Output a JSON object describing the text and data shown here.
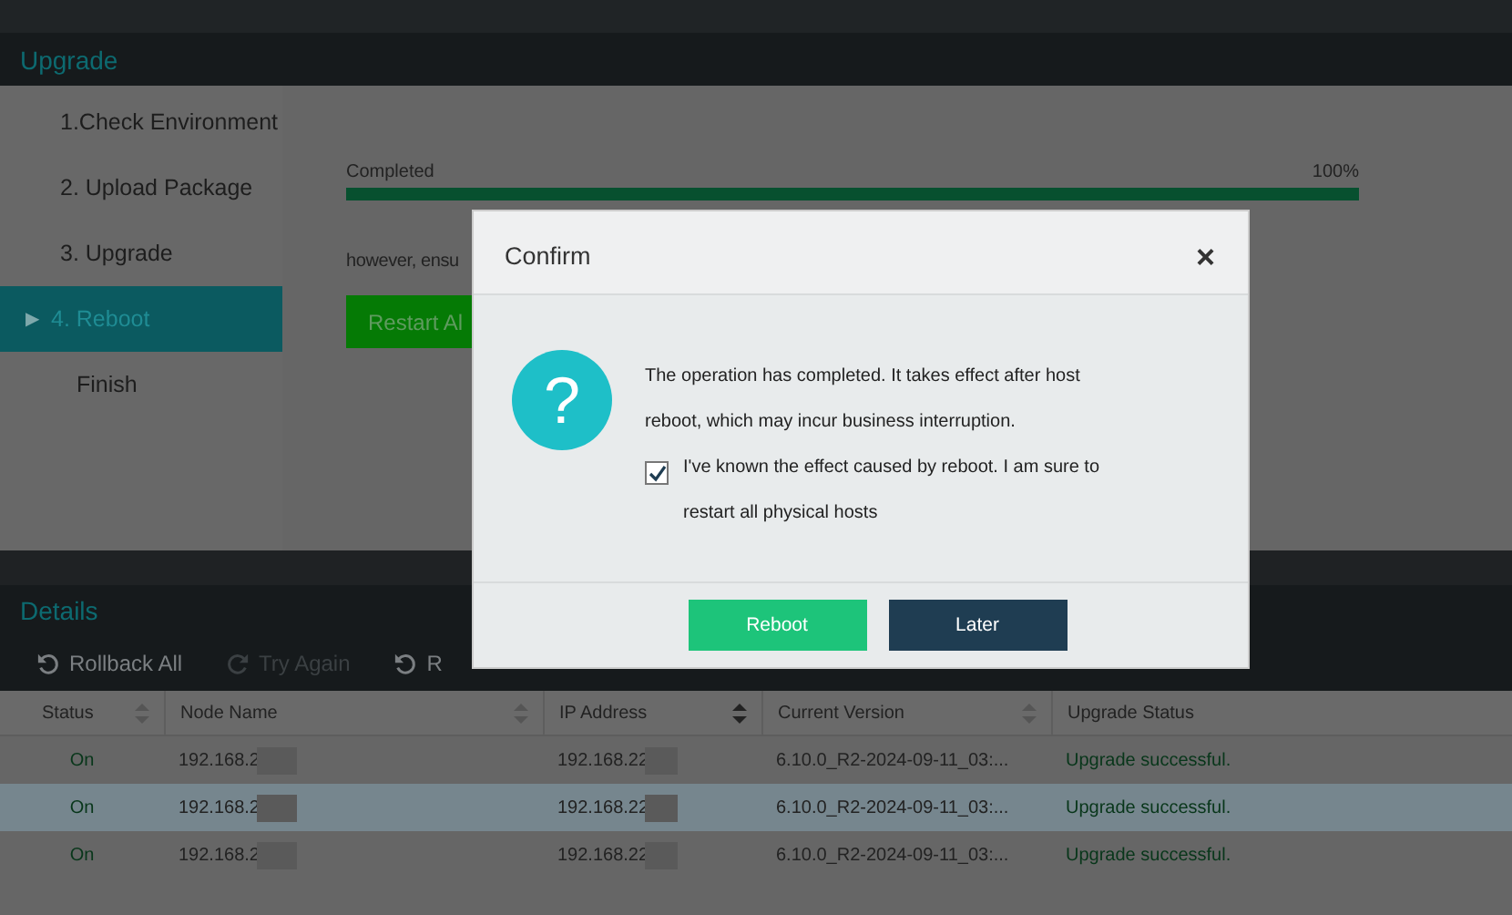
{
  "upgrade": {
    "title": "Upgrade",
    "steps": [
      {
        "label": "1.Check Environment",
        "selected": false
      },
      {
        "label": "2. Upload Package",
        "selected": false
      },
      {
        "label": "3. Upgrade",
        "selected": false
      },
      {
        "label": "4. Reboot",
        "selected": true,
        "marker": "▶"
      },
      {
        "label": "Finish",
        "selected": false
      }
    ],
    "progress": {
      "label": "Completed",
      "reading": "100%",
      "level": 1
    },
    "note": "however, ensu",
    "restart_button": "Restart Al"
  },
  "details": {
    "title": "Details",
    "toolbar": [
      {
        "label": "Rollback All",
        "disabled": false
      },
      {
        "label": "Try Again",
        "disabled": true
      },
      {
        "label": "R",
        "disabled": false
      }
    ],
    "columns": [
      {
        "label": "Status",
        "sortable": true
      },
      {
        "label": "Node Name",
        "sortable": true
      },
      {
        "label": "IP Address",
        "sortable": true
      },
      {
        "label": "Current Version",
        "sortable": true
      },
      {
        "label": "Upgrade Status",
        "sortable": false
      }
    ],
    "rows": [
      {
        "status": "On",
        "node": "192.168.2",
        "ip": "192.168.22",
        "version": "6.10.0_R2-2024-09-11_03:...",
        "result": "Upgrade successful.",
        "selected": false
      },
      {
        "status": "On",
        "node": "192.168.2",
        "ip": "192.168.22",
        "version": "6.10.0_R2-2024-09-11_03:...",
        "result": "Upgrade successful.",
        "selected": true
      },
      {
        "status": "On",
        "node": "192.168.2",
        "ip": "192.168.22",
        "version": "6.10.0_R2-2024-09-11_03:...",
        "result": "Upgrade successful.",
        "selected": false
      }
    ]
  },
  "dialog": {
    "title": "Confirm",
    "close": "×",
    "icon": "?",
    "message": "The operation has completed. It takes effect after host reboot, which may incur business interruption.",
    "checkbox": {
      "label": "I've known the effect caused by reboot. I am sure to restart all physical hosts",
      "checked": true
    },
    "buttons": [
      {
        "label": "Reboot",
        "kind": "primary"
      },
      {
        "label": "Later",
        "kind": "secondary"
      }
    ]
  }
}
